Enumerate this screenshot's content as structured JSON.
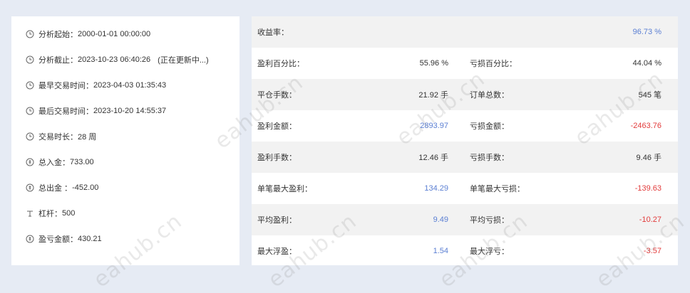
{
  "info": {
    "items": [
      {
        "icon": "clock-icon",
        "label": "分析起始：",
        "value": "2000-01-01 00:00:00",
        "note": ""
      },
      {
        "icon": "clock-icon",
        "label": "分析截止：",
        "value": "2023-10-23 06:40:26",
        "note": "(正在更新中...)"
      },
      {
        "icon": "clock-icon",
        "label": "最早交易时间：",
        "value": "2023-04-03 01:35:43",
        "note": ""
      },
      {
        "icon": "clock-icon",
        "label": "最后交易时间：",
        "value": "2023-10-20 14:55:37",
        "note": ""
      },
      {
        "icon": "clock-icon",
        "label": "交易时长：",
        "value": "28 周",
        "note": ""
      },
      {
        "icon": "coin-icon",
        "label": "总入金：",
        "value": "733.00",
        "note": ""
      },
      {
        "icon": "coin-icon",
        "label": "总出金 ：",
        "value": "-452.00",
        "note": ""
      },
      {
        "icon": "lever-icon",
        "label": "杠杆：",
        "value": "500",
        "note": ""
      },
      {
        "icon": "coin-icon",
        "label": "盈亏金额：",
        "value": "430.21",
        "note": ""
      }
    ]
  },
  "stats": {
    "yield_label": "收益率：",
    "yield_value": "96.73 %",
    "rows": [
      {
        "l1": "盈利百分比：",
        "v1": "55.96 %",
        "c1": "dark",
        "l2": "亏损百分比：",
        "v2": "44.04 %",
        "c2": "dark"
      },
      {
        "l1": "平仓手数：",
        "v1": "21.92 手",
        "c1": "dark",
        "l2": "订单总数：",
        "v2": "545 笔",
        "c2": "dark"
      },
      {
        "l1": "盈利金额：",
        "v1": "2893.97",
        "c1": "blue",
        "l2": "亏损金额：",
        "v2": "-2463.76",
        "c2": "red"
      },
      {
        "l1": "盈利手数：",
        "v1": "12.46 手",
        "c1": "dark",
        "l2": "亏损手数：",
        "v2": "9.46 手",
        "c2": "dark"
      },
      {
        "l1": "单笔最大盈利：",
        "v1": "134.29",
        "c1": "blue",
        "l2": "单笔最大亏损：",
        "v2": "-139.63",
        "c2": "red"
      },
      {
        "l1": "平均盈利：",
        "v1": "9.49",
        "c1": "blue",
        "l2": "平均亏损：",
        "v2": "-10.27",
        "c2": "red"
      },
      {
        "l1": "最大浮盈：",
        "v1": "1.54",
        "c1": "blue",
        "l2": "最大浮亏：",
        "v2": "-3.57",
        "c2": "red"
      }
    ]
  },
  "watermark": "eahub.cn",
  "colors": {
    "blue": "#5b7fd3",
    "red": "#e23b3b",
    "gray_row": "#f2f2f2",
    "background": "#e6ebf4"
  }
}
